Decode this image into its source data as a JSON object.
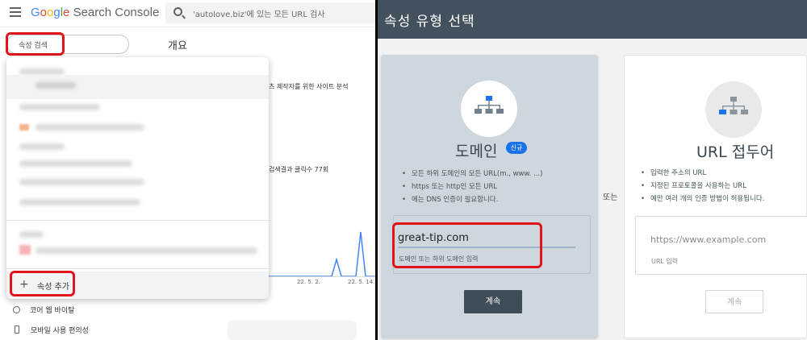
{
  "left": {
    "app_name": "Search Console",
    "search": {
      "placeholder": "'autolove.biz'에 있는 모든 URL 검사"
    },
    "property_search": {
      "placeholder": "속성 검색"
    },
    "page_title": "개요",
    "dropdown": {
      "add_property_label": "속성 추가"
    },
    "background": {
      "line1": "츠 제작자를 위한 사이트 분석",
      "line2": "검색결과 클릭수 77회",
      "axis_labels": [
        "22. 5. 2.",
        "22. 5. 14."
      ]
    },
    "nav": [
      {
        "label": "코어 웹 바이탈",
        "icon": "gauge-icon"
      },
      {
        "label": "모바일 사용 편의성",
        "icon": "phone-icon"
      }
    ]
  },
  "right": {
    "title": "속성 유형 선택",
    "separator": "또는",
    "domain": {
      "title": "도메인",
      "badge": "신규",
      "bullets": [
        "모든 하위 도메인의 모든 URL(m., www. ...)",
        "https 또는 http인 모든 URL",
        "에는 DNS 인증이 필요합니다."
      ],
      "input_value": "great-tip.com",
      "input_hint": "도메인 또는 하위 도메인 입력",
      "button": "계속"
    },
    "url_prefix": {
      "title": "URL 접두어",
      "bullets": [
        "입력한 주소의 URL",
        "지정된 프로토콜을 사용하는 URL",
        "예만 여러 개의 인증 방법이 허용됩니다."
      ],
      "input_placeholder": "https://www.example.com",
      "input_hint": "URL 입력",
      "button": "계속"
    }
  },
  "colors": {
    "header": "#42515d",
    "domain_card": "#cdd7dd",
    "highlight_red": "#e0141a",
    "badge_blue": "#1a73e8",
    "button_dark": "#3f4d58"
  }
}
